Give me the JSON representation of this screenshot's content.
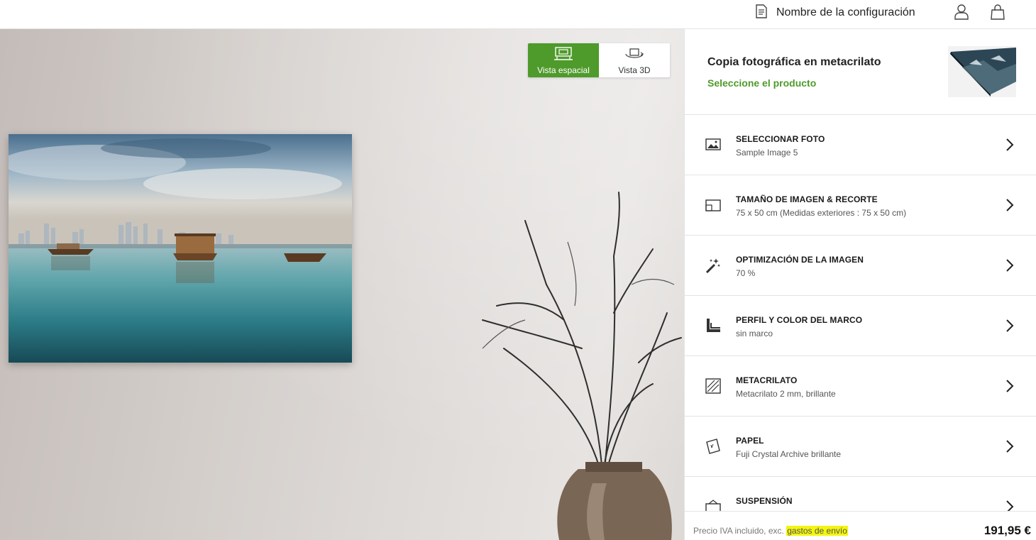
{
  "header": {
    "config_name": "Nombre de la configuración",
    "icons": [
      "document-icon",
      "user-icon",
      "shopping-bag-icon"
    ]
  },
  "preview": {
    "view_toggle": [
      {
        "label": "Vista espacial",
        "active": true
      },
      {
        "label": "Vista 3D",
        "active": false
      }
    ],
    "accent_color": "#4e9a2b"
  },
  "product": {
    "title": "Copia fotográfica en metacrilato",
    "select_label": "Seleccione el producto"
  },
  "options": [
    {
      "title": "SELECCIONAR FOTO",
      "value": "Sample Image 5",
      "icon": "image-icon"
    },
    {
      "title": "TAMAÑO DE IMAGEN & RECORTE",
      "value": "75 x 50 cm (Medidas exteriores : 75 x 50 cm)",
      "icon": "crop-size-icon"
    },
    {
      "title": "OPTIMIZACIÓN DE LA IMAGEN",
      "value": "70 %",
      "icon": "magic-wand-icon"
    },
    {
      "title": "PERFIL Y COLOR DEL MARCO",
      "value": "sin marco",
      "icon": "frame-profile-icon"
    },
    {
      "title": "METACRILATO",
      "value": "Metacrilato 2 mm, brillante",
      "icon": "acrylic-glass-icon"
    },
    {
      "title": "PAPEL",
      "value": "Fuji Crystal Archive brillante",
      "icon": "paper-icon"
    },
    {
      "title": "SUSPENSIÓN",
      "value": "",
      "icon": "hanging-icon"
    }
  ],
  "footer": {
    "price_note": "Precio IVA incluido, exc.",
    "shipping_link": "gastos de envío",
    "price": "191,95 €",
    "highlight_color": "#f3f50f"
  }
}
